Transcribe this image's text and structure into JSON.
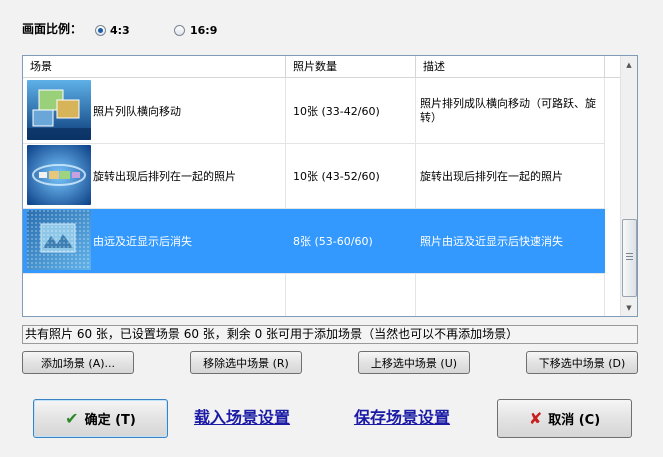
{
  "aspect": {
    "label": "画面比例：",
    "options": [
      {
        "label": "4:3",
        "selected": true
      },
      {
        "label": "16:9",
        "selected": false
      }
    ]
  },
  "table": {
    "columns": [
      "场景",
      "照片数量",
      "描述"
    ],
    "rows": [
      {
        "scene": "照片列队横向移动",
        "count": "10张 (33-42/60)",
        "desc": "照片排列成队横向移动（可路跃、旋转）",
        "selected": false
      },
      {
        "scene": "旋转出现后排列在一起的照片",
        "count": "10张 (43-52/60)",
        "desc": "旋转出现后排列在一起的照片",
        "selected": false
      },
      {
        "scene": "由远及近显示后消失",
        "count": "8张 (53-60/60)",
        "desc": "照片由远及近显示后快速消失",
        "selected": true
      }
    ]
  },
  "status": "共有照片 60 张，已设置场景 60 张，剩余 0 张可用于添加场景（当然也可以不再添加场景）",
  "buttons": {
    "add": "添加场景 (A)...",
    "remove": "移除选中场景 (R)",
    "up": "上移选中场景 (U)",
    "down": "下移选中场景 (D)",
    "ok": "确定 (T)",
    "cancel": "取消 (C)"
  },
  "links": {
    "load": "载入场景设置",
    "save": "保存场景设置"
  },
  "colors": {
    "selection": "#3399ff",
    "link": "#1a1aa6"
  }
}
